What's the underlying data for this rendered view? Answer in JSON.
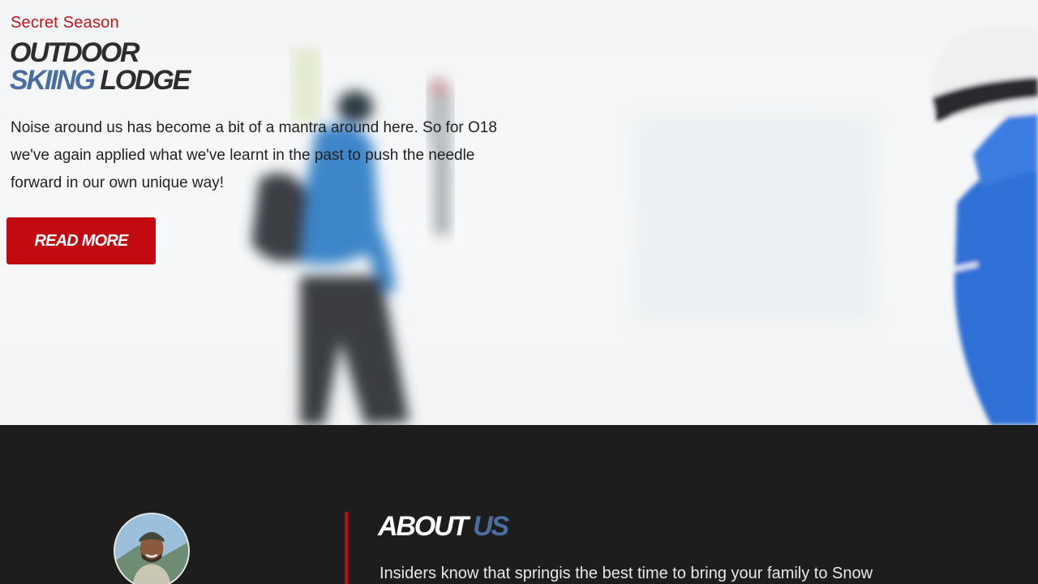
{
  "hero": {
    "kicker": "Secret Season",
    "title_line1": "OUTDOOR",
    "title_line2_accent": "SKIING",
    "title_line2_rest": "LODGE",
    "lead": "Noise around us has become a bit of a mantra around here. So for O18 we've again applied what we've learnt in the past to push the needle forward in our own unique way!",
    "button_label": "READ MORE"
  },
  "about": {
    "title_main": "ABOUT",
    "title_accent": "US",
    "text": "Insiders know that springis the best time to bring your family to Snow"
  },
  "colors": {
    "accent_red": "#c10b10",
    "accent_blue": "#4a6e9f",
    "dark_bg": "#1d1d1e"
  }
}
